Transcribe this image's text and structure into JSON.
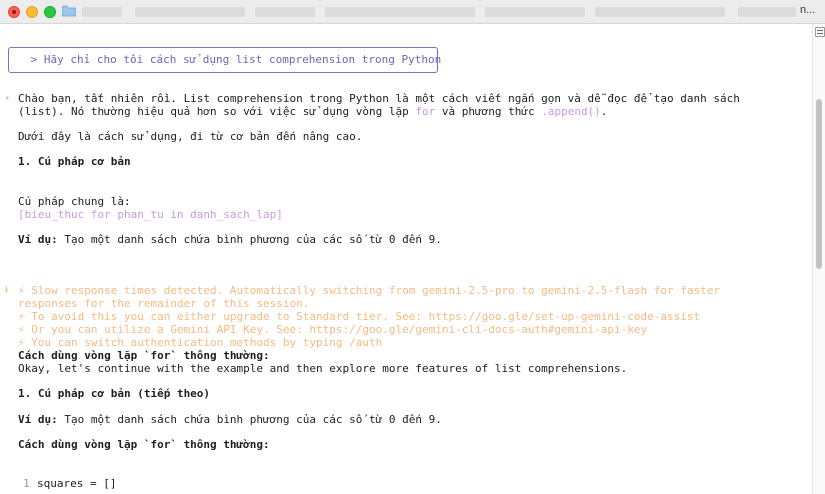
{
  "window": {
    "title_end": "n..."
  },
  "prompt": {
    "text": " > Hãy chỉ cho tôi cách sử dụng list comprehension trong Python"
  },
  "response": {
    "intro_1": "Chào bạn, tất nhiên rồi. List comprehension trong Python là một cách viết ngắn gọn và dễ đọc để tạo danh sách",
    "intro_2a": "(list). Nó thường hiệu quả hơn so với việc sử dụng vòng lặp ",
    "intro_2b": "for",
    "intro_2c": " và phương thức ",
    "intro_2d": ".append()",
    "intro_2e": ".",
    "intro_3": "Dưới đây là cách sử dụng, đi từ cơ bản đến nâng cao.",
    "heading_1": "1. Cú pháp cơ bản",
    "syntax_label": "Cú pháp chung là:",
    "syntax_code": "[bieu_thuc for phan_tu in danh_sach_lap]",
    "example_label": "Ví dụ:",
    "example_text": " Tạo một danh sách chứa bình phương của các số từ 0 đến 9."
  },
  "warning": {
    "line_1": "⚡ Slow response times detected. Automatically switching from gemini-2.5-pro to gemini-2.5-flash for faster",
    "line_2": "responses for the remainder of this session.",
    "line_3": "⚡ To avoid this you can either upgrade to Standard tier. See: https://goo.gle/set-up-gemini-code-assist",
    "line_4": "⚡ Or you can utilize a Gemini API Key. See: https://goo.gle/gemini-cli-docs-auth#gemini-api-key",
    "line_5": "⚡ You can switch authentication methods by typing /auth"
  },
  "continued": {
    "loop_heading": "Cách dùng vòng lặp `for` thông thường:",
    "okay_line": "Okay, let's continue with the example and then explore more features of list comprehensions.",
    "heading_1b": "1. Cú pháp cơ bản (tiếp theo)",
    "example_label": "Ví dụ:",
    "example_text": " Tạo một danh sách chứa bình phương của các số từ 0 đến 9.",
    "loop_heading_2": "Cách dùng vòng lặp `for` thông thường:"
  },
  "code": {
    "line_number": "1",
    "line_text": "squares = []"
  },
  "markers": {
    "response": "✦",
    "warning": "ℹ"
  },
  "colors": {
    "prompt_border": "#7b6fc9",
    "purple": "#c79ae0",
    "orange": "#f5bb82"
  }
}
